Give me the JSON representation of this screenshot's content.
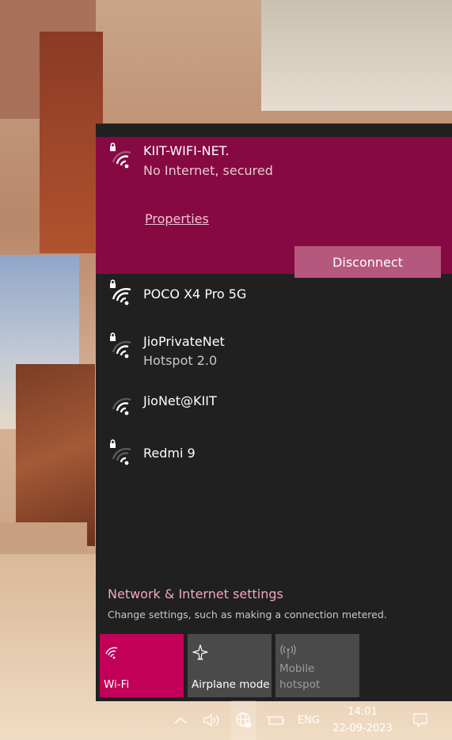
{
  "networks": [
    {
      "name": "KIIT-WIFI-NET.",
      "status": "No Internet, secured",
      "secured": true,
      "signal": "weak",
      "connected": true
    },
    {
      "name": "POCO X4 Pro 5G",
      "status": "",
      "secured": true,
      "signal": "full"
    },
    {
      "name": "JioPrivateNet",
      "status": "Hotspot 2.0",
      "secured": true,
      "signal": "strong"
    },
    {
      "name": "JioNet@KIIT",
      "status": "",
      "secured": false,
      "signal": "strong"
    },
    {
      "name": "Redmi 9",
      "status": "",
      "secured": true,
      "signal": "weak"
    }
  ],
  "selected": {
    "properties_label": "Properties",
    "disconnect_label": "Disconnect"
  },
  "settings": {
    "link": "Network & Internet settings",
    "description": "Change settings, such as making a connection metered."
  },
  "quick_actions": [
    {
      "label": "Wi-Fi",
      "icon": "wifi-icon",
      "state": "on"
    },
    {
      "label": "Airplane mode",
      "icon": "airplane-icon",
      "state": "off"
    },
    {
      "label": "Mobile\nhotspot",
      "icon": "hotspot-icon",
      "state": "disabled"
    }
  ],
  "taskbar": {
    "language": "ENG",
    "time": "14:01",
    "date": "22-09-2023"
  },
  "colors": {
    "accent": "#c2005a",
    "selected_bg": "#870942",
    "flyout_bg": "#202020",
    "link": "#f0a7c6"
  }
}
